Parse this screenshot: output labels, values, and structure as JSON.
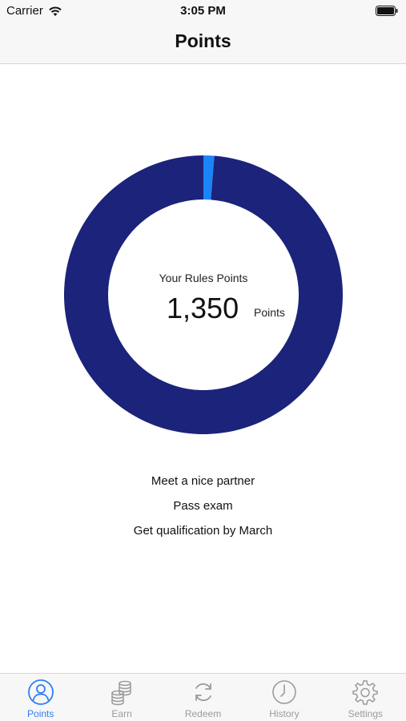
{
  "status_bar": {
    "carrier": "Carrier",
    "time": "3:05 PM"
  },
  "nav": {
    "title": "Points"
  },
  "points_summary": {
    "caption": "Your Rules Points",
    "value": "1,350",
    "unit": "Points"
  },
  "chart_data": {
    "type": "pie",
    "values": [
      0.0125,
      0.9875
    ],
    "colors": [
      "#1a84f8",
      "#1b237a"
    ]
  },
  "goals": [
    "Meet a nice partner",
    "Pass exam",
    "Get qualification by March"
  ],
  "tabs": [
    {
      "label": "Points",
      "icon": "person-icon",
      "active": true
    },
    {
      "label": "Earn",
      "icon": "coins-icon",
      "active": false
    },
    {
      "label": "Redeem",
      "icon": "refresh-icon",
      "active": false
    },
    {
      "label": "History",
      "icon": "clock-icon",
      "active": false
    },
    {
      "label": "Settings",
      "icon": "gear-icon",
      "active": false
    }
  ],
  "colors": {
    "accent": "#2f7ef7",
    "inactive": "#9b9b9b",
    "ring_main": "#1b237a",
    "ring_highlight": "#1a84f8"
  }
}
